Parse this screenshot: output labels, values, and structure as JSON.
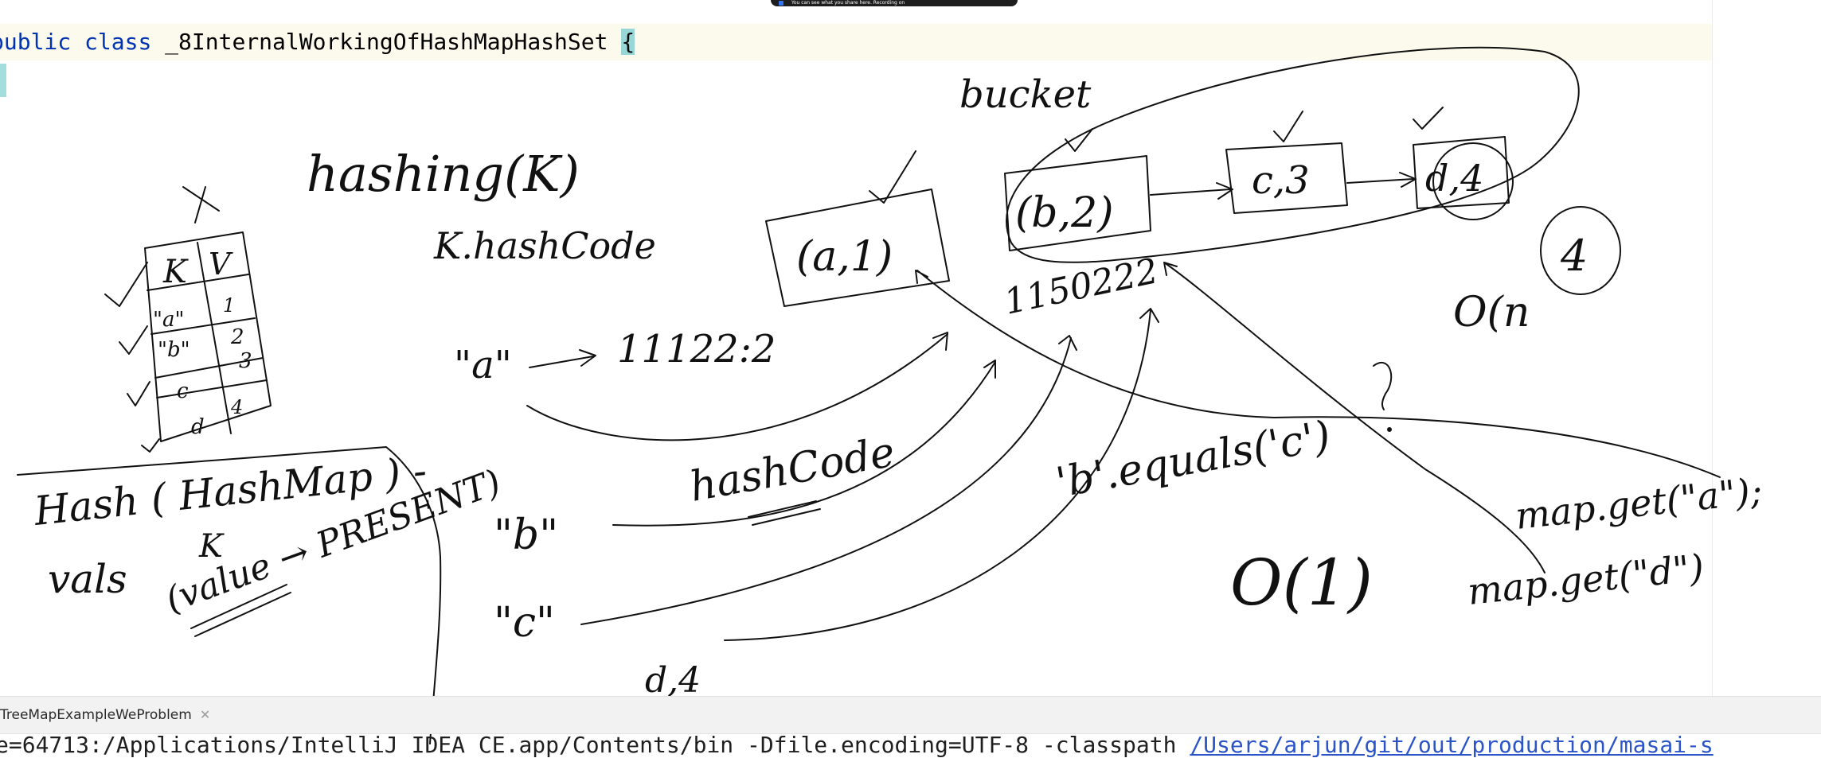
{
  "editor": {
    "code_line": {
      "keyword_public": "public",
      "keyword_class": "class",
      "class_name": "_8InternalWorkingOfHashMapHashSet",
      "open_brace": "{"
    }
  },
  "notification": {
    "text": "You can see what you share here. Recording on"
  },
  "run_tab": {
    "label": "TreeMapExampleWeProblem",
    "close_glyph": "✕"
  },
  "console": {
    "plain_text": "e=64713:/Applications/IntelliJ IDEA CE.app/Contents/bin -Dfile.encoding=UTF-8 -classpath ",
    "link_text": "/Users/arjun/git/out/production/masai-s"
  },
  "annotations": {
    "hashing": "hashing(K)",
    "k_hashcode": "K.hashCode",
    "bucket": "bucket",
    "table_k": "K",
    "table_v": "V",
    "table_rows": [
      {
        "k": "\"a\"",
        "v": "1"
      },
      {
        "k": "\"b\"",
        "v": "2"
      },
      {
        "k": "c",
        "v": "3"
      },
      {
        "k": "d",
        "v": "4"
      }
    ],
    "entry_a1": "(a,1)",
    "entry_b2": "(b,2)",
    "entry_c3": "c,3",
    "entry_d4": "d,4",
    "hash_number_a": "11122:2",
    "hash_number_bucket": "1150222",
    "key_a": "\"a\"",
    "key_b": "\"b\"",
    "key_c": "\"c\"",
    "key_d4": "d,4",
    "hashcode_label": "hashCode",
    "b_equals_c": "'b'.equals('c')",
    "o_one": "O(1)",
    "o_n": "O(n",
    "four_circled": "4",
    "map_get_a": "map.get(\"a\");",
    "map_get_d": "map.get(\"d\")",
    "hash_hashmap": "Hash ( HashMap ) - ",
    "k_label": "K",
    "vals_label": "vals",
    "value_present": "(value → PRESENT)"
  },
  "colors": {
    "keyword": "#0033b3",
    "caret_line": "#fcfaed",
    "brace_highlight": "#99d6d6",
    "link": "#2a54c8",
    "ink": "#111111"
  }
}
